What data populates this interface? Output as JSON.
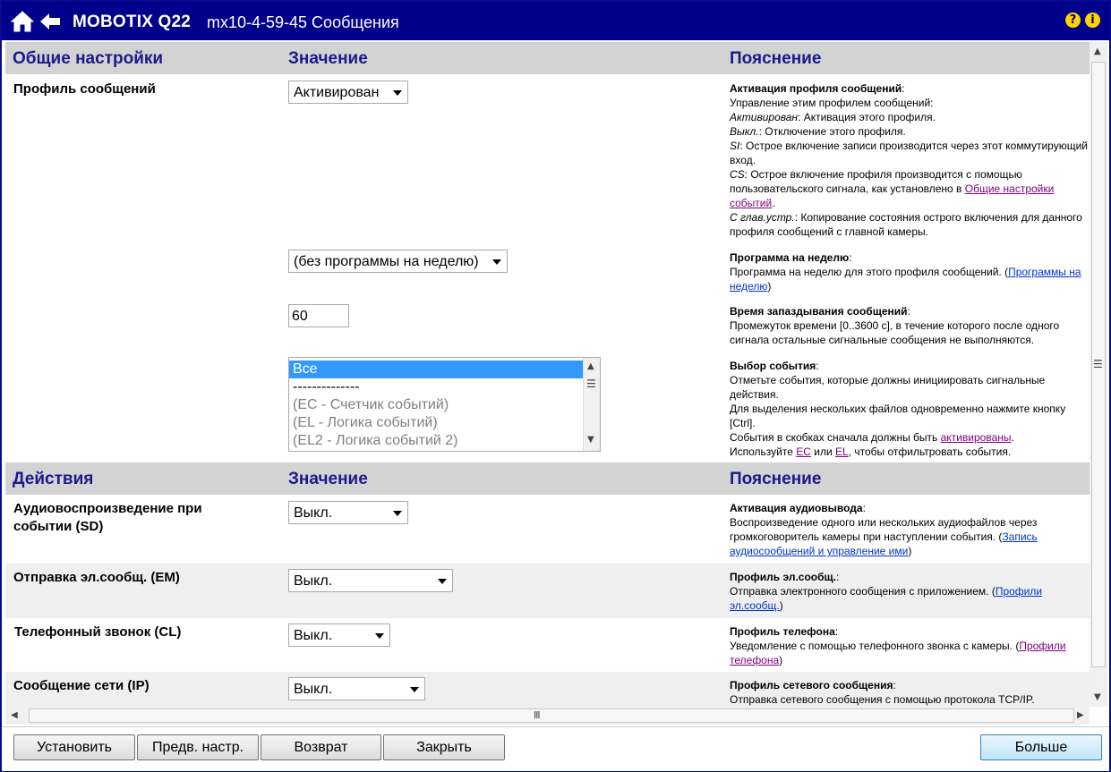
{
  "titlebar": {
    "brand": "MOBOTIX Q22",
    "subtitle": "mx10-4-59-45 Сообщения",
    "help_icon": "?",
    "info_icon": "i"
  },
  "section1": {
    "col1": "Общие настройки",
    "col2": "Значение",
    "col3": "Пояснение",
    "profile_label": "Профиль сообщений",
    "profile_select": "Активирован",
    "program_select": "(без программы на неделю)",
    "delay_value": "60",
    "event_options": [
      "Все",
      "--------------",
      "(EC - Счетчик событий)",
      "(EL - Логика событий)",
      "(EL2 - Логика событий 2)"
    ],
    "expl_activation": {
      "title": "Активация профиля сообщений",
      "colon": ":",
      "line1": "Управление этим профилем сообщений:",
      "a_term": "Активирован",
      "a_text": ": Активация этого профиля.",
      "off_term": "Выкл.",
      "off_text": ": Отключение этого профиля.",
      "si_term": "SI",
      "si_text": ": Острое включение записи производится через этот коммутирующий вход.",
      "cs_term": "CS",
      "cs_text": ": Острое включение профиля производится с помощью пользовательского сигнала, как установлено в ",
      "cs_link": "Общие настройки событий",
      "cs_end": ".",
      "main_term": "С глав.устр.",
      "main_text": ": Копирование состояния острого включения для данного профиля сообщений с главной камеры."
    },
    "expl_program": {
      "title": "Программа на неделю",
      "colon": ":",
      "text": "Программа на неделю для этого профиля сообщений. (",
      "link": "Программы на неделю",
      "end": ")"
    },
    "expl_delay": {
      "title": "Время запаздывания сообщений",
      "colon": ":",
      "text": "Промежуток времени [0..3600 с], в течение которого после одного сигнала остальные сигнальные сообщения не выполняются."
    },
    "expl_events": {
      "title": "Выбор события",
      "colon": ":",
      "text1": "Отметьте события, которые должны инициировать сигнальные действия.",
      "text2": "Для выделения нескольких файлов одновременно нажмите кнопку [Ctrl].",
      "text3": "События в скобках сначала должны быть ",
      "link_act": "активированы",
      "text4": ".",
      "text5": "Используйте ",
      "link_ec": "EC",
      "or": " или ",
      "link_el": "EL",
      "text6": ", чтобы отфильтровать события."
    }
  },
  "section2": {
    "col1": "Действия",
    "col2": "Значение",
    "col3": "Пояснение",
    "rows": [
      {
        "label": "Аудиовоспроизведение при событии (SD)",
        "value": "Выкл.",
        "title": "Активация аудиовывода",
        "colon": ":",
        "text": "Воспроизведение одного или нескольких аудиофайлов через громкоговоритель камеры при наступлении события. (",
        "link": "Запись аудиосообщений и управление ими",
        "end": ")"
      },
      {
        "label": "Отправка эл.сообщ. (EM)",
        "value": "Выкл.",
        "title": "Профиль эл.сообщ.",
        "colon": ":",
        "text": "Отправка электронного сообщения с приложением. (",
        "link": "Профили эл.сообщ.",
        "end": ")"
      },
      {
        "label": "Телефонный звонок (CL)",
        "value": "Выкл.",
        "title": "Профиль телефона",
        "colon": ":",
        "text": "Уведомление с помощью телефонного звонка с камеры. (",
        "link": "Профили телефона",
        "end": ")"
      },
      {
        "label": "Сообщение сети (IP)",
        "value": "Выкл.",
        "title": "Профиль сетевого сообщения",
        "colon": ":",
        "text": "Отправка сетевого сообщения с помощью протокола TCP/IP.",
        "link": "",
        "end": ""
      }
    ]
  },
  "footer": {
    "set": "Установить",
    "defaults": "Предв. настр.",
    "restore": "Возврат",
    "close": "Закрыть",
    "more": "Больше"
  },
  "icons": {
    "home": "home-icon",
    "back": "back-arrow-icon",
    "help": "help-icon",
    "info": "info-icon"
  },
  "colors": {
    "titlebar": "#00008b",
    "header_text": "#1a1a8c",
    "header_bg": "#d3d3d3",
    "selection": "#3399ff"
  }
}
